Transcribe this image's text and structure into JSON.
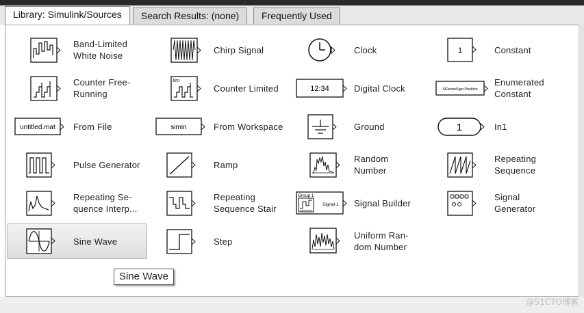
{
  "tabs": [
    {
      "label": "Library: Simulink/Sources",
      "active": true
    },
    {
      "label": "Search Results: (none)",
      "active": false
    },
    {
      "label": "Frequently Used",
      "active": false
    }
  ],
  "blocks": {
    "band_limited_white_noise": "Band-Limited\nWhite Noise",
    "chirp_signal": "Chirp Signal",
    "clock": "Clock",
    "constant": "Constant",
    "constant_value": "1",
    "counter_free_running": "Counter Free-\nRunning",
    "counter_limited": "Counter Limited",
    "counter_limited_mark": "lim",
    "digital_clock": "Digital Clock",
    "digital_clock_value": "12:34",
    "enumerated_constant": "Enumerated\nConstant",
    "enumerated_constant_value": "SlDemoSign.Positive",
    "from_file": "From File",
    "from_file_value": "untitled.mat",
    "from_workspace": "From Workspace",
    "from_workspace_value": "simin",
    "ground": "Ground",
    "in1": "In1",
    "in1_value": "1",
    "pulse_generator": "Pulse Generator",
    "ramp": "Ramp",
    "random_number": "Random\nNumber",
    "repeating_sequence": "Repeating\nSequence",
    "repeating_sequence_interp": "Repeating Se-\nquence Interp...",
    "repeating_sequence_stair": "Repeating\nSequence Stair",
    "signal_builder": "Signal Builder",
    "signal_builder_group": "Group 1",
    "signal_builder_signal": "Signal 1",
    "signal_generator": "Signal\nGenerator",
    "sine_wave": "Sine Wave",
    "step": "Step",
    "uniform_random_number": "Uniform Ran-\ndom Number"
  },
  "tooltip": "Sine Wave",
  "watermark": "@51CTO博客",
  "colors": {
    "selected_bg": "#e6e6e6",
    "panel_border": "#9a9a9a",
    "tab_bg": "#dcdcdc"
  }
}
